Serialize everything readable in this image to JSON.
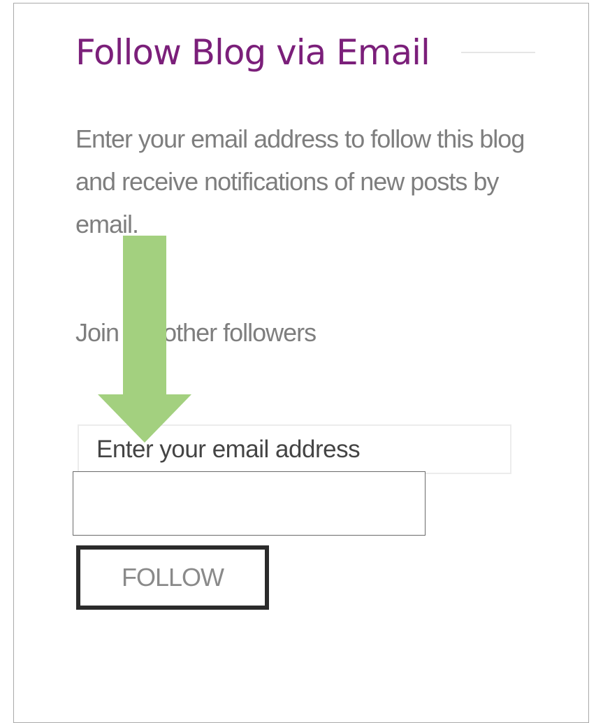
{
  "widget": {
    "title": "Follow Blog via Email",
    "description": "Enter your email address to follow this blog and receive notifications of new posts by email.",
    "followers_prefix": "Join",
    "followers_suffix": "other followers",
    "email_placeholder": "Enter your email address",
    "follow_label": "FOLLOW"
  },
  "colors": {
    "title": "#7b1f7a",
    "body_text": "#7e7e7e",
    "arrow": "#a3d07f",
    "button_border": "#2b2b2b"
  },
  "icons": {
    "annotation": "down-arrow-icon"
  }
}
